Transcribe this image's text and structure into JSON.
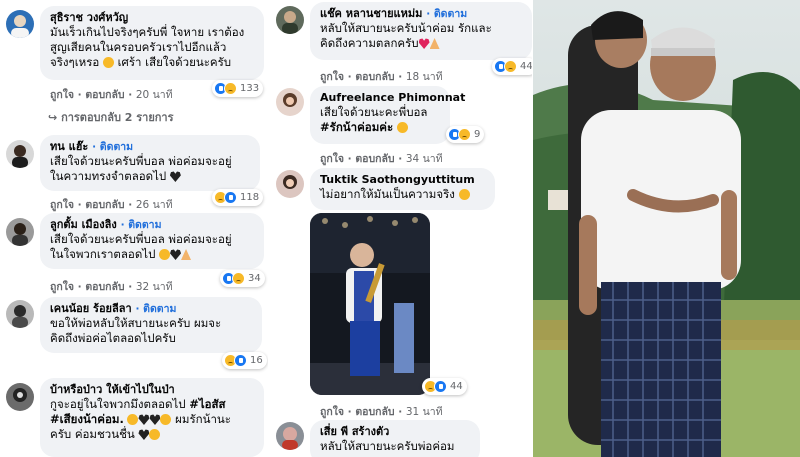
{
  "labels": {
    "like": "ถูกใจ",
    "reply": "ตอบกลับ",
    "dot": "·",
    "follow": "· ติดตาม"
  },
  "colors": {
    "accent": "#216fdb",
    "bubble": "#f0f2f5",
    "meta": "#65676b"
  },
  "left": {
    "comments": [
      {
        "name": "สุธิราช วงศ์หวัญ",
        "follow": false,
        "lines": [
          "มันเร็วเกินไปจริงๆครับพี่ ใจหาย เราต้อง",
          "สูญเสียคนในครอบครัวเราไปอีกแล้ว",
          "จริงๆเหรอ "
        ],
        "line3_suffix": " เศร้า เสียใจด้วยนะครับ",
        "time": "20 นาที",
        "reactions": "133",
        "replies": "การตอบกลับ 2 รายการ"
      },
      {
        "name": "ทน แฮ๊ะ",
        "follow": true,
        "lines": [
          "เสียใจด้วยนะครับพี่บอล พ่อค่อมจะอยู่",
          "ในความทรงจำตลอดไป "
        ],
        "time": "26 นาที",
        "reactions": "118"
      },
      {
        "name": "ลูกตั้ม เมืองลิง",
        "follow": true,
        "lines": [
          "เสียใจด้วยนะครับพี่บอล พ่อค่อมจะอยู่",
          "ในใจพวกเราตลอดไป "
        ],
        "time": "32 นาที",
        "reactions": "34"
      },
      {
        "name": "เคนน้อย ร้อยลีลา",
        "follow": true,
        "lines": [
          "ขอให้พ่อหลับให้สบายนะครับ ผมจะ",
          "คิดถึงพ่อค่อไตลอดไปครับ"
        ],
        "time": "",
        "reactions": "16"
      },
      {
        "name": "บ้าหรือป่าว ให้เข้าไปในป่า",
        "follow": false,
        "lines": [
          "กูจะอยู่ในใจพวกมึงตลอดไป ",
          "",
          "ครับ ค่อมชวนชื่น "
        ],
        "line1_tag": "#ไอสัส",
        "line2_tag": "#เสียงน้าค่อม.",
        "line2_suffix": " ผมรักน้านะ"
      }
    ]
  },
  "middle": {
    "comments": [
      {
        "name": "แช๊ค หลานชายแหม่ม",
        "follow": true,
        "lines": [
          "หลับให้สบายนะครับน้าค่อม รักและ",
          "คิดถึงความตลกครับ"
        ],
        "time": "18 นาที",
        "reactions": "44"
      },
      {
        "name": "Aufreelance Phimonnat",
        "follow": false,
        "lines": [
          "เสียใจด้วยนะคะพี่บอล"
        ],
        "tag": "#รักน้าค่อมค่ะ",
        "time": "34 นาที",
        "reactions": "9"
      },
      {
        "name": "Tuktik Saothongyuttitum",
        "follow": false,
        "lines": [
          "ไม่อยากให้มันเป็นความจริง "
        ],
        "time": "31 นาที",
        "reactions": "44"
      },
      {
        "name": "เสี่ย พี สร้างตัว",
        "follow": false,
        "lines": [
          "หลับให้สบายนะครับพ่อค่อม"
        ]
      }
    ]
  }
}
